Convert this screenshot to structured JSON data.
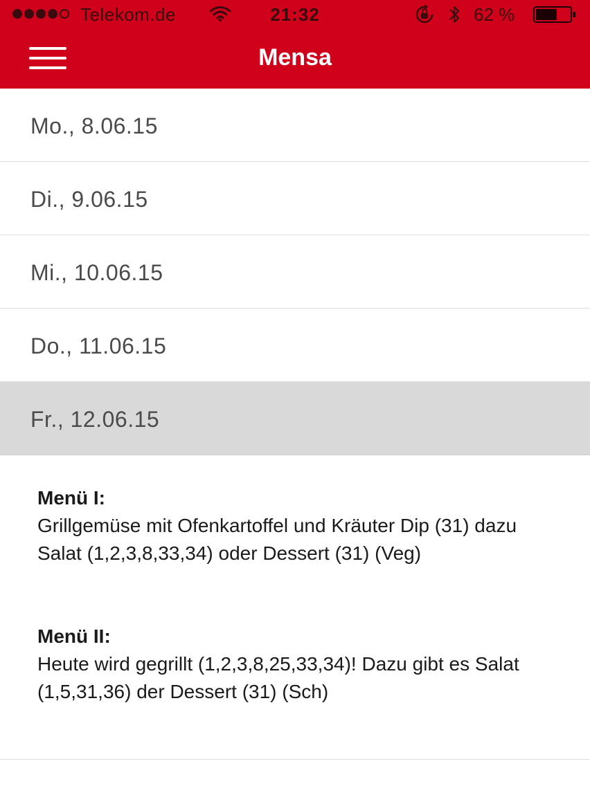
{
  "status_bar": {
    "carrier": "Telekom.de",
    "time": "21:32",
    "battery_percent": "62 %",
    "battery_level": 0.62,
    "signal_bars_filled": 4,
    "signal_bars_total": 5,
    "icons": [
      "wifi-icon",
      "lock-rotation-icon",
      "bluetooth-icon",
      "battery-icon"
    ]
  },
  "nav": {
    "title": "Mensa",
    "menu_icon": "hamburger-icon"
  },
  "days": [
    {
      "label": "Mo., 8.06.15",
      "selected": false
    },
    {
      "label": "Di., 9.06.15",
      "selected": false
    },
    {
      "label": "Mi., 10.06.15",
      "selected": false
    },
    {
      "label": "Do., 11.06.15",
      "selected": false
    },
    {
      "label": "Fr., 12.06.15",
      "selected": true
    }
  ],
  "menus": [
    {
      "title": "Menü I:",
      "text": "Grillgemüse mit Ofenkartoffel und Kräuter Dip (31) dazu Salat (1,2,3,8,33,34) oder Dessert (31) (Veg)"
    },
    {
      "title": "Menü II:",
      "text": "Heute wird gegrillt (1,2,3,8,25,33,34)! Dazu gibt es Salat (1,5,31,36) der Dessert (31) (Sch)"
    }
  ],
  "colors": {
    "brand_red": "#d0021b",
    "selected_row": "#d9d9d9",
    "row_text": "#4a4a4a",
    "divider": "#dedede"
  }
}
